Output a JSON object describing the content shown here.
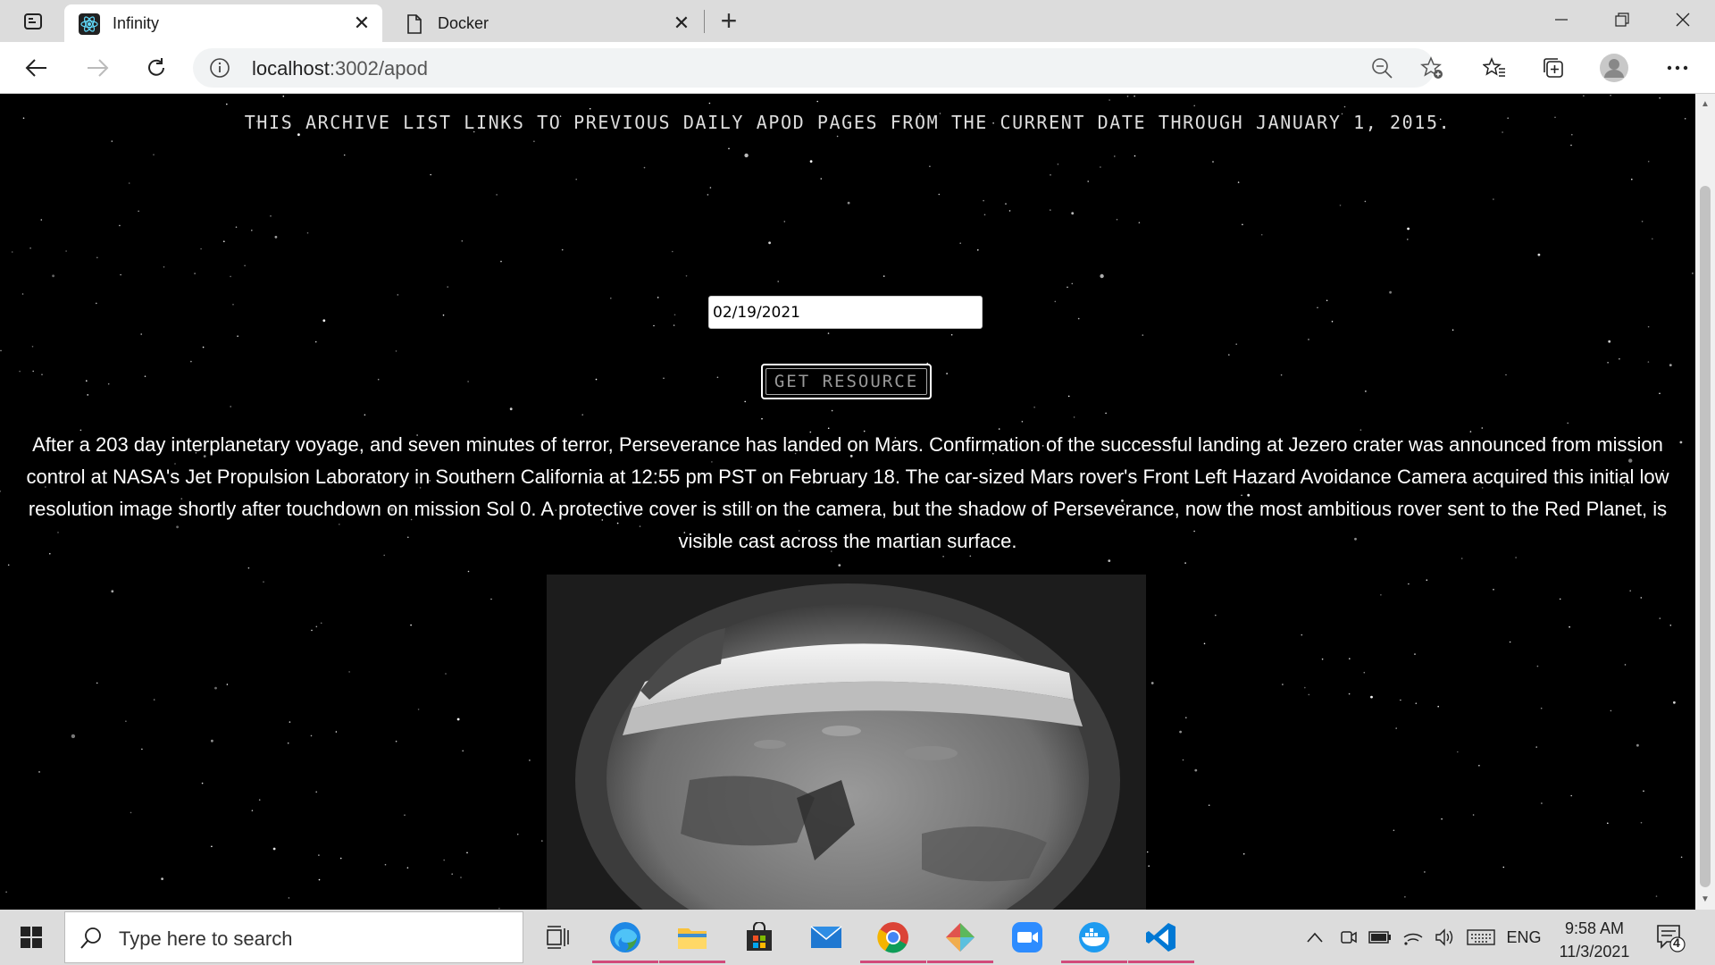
{
  "browser": {
    "tabs": [
      {
        "title": "Infinity",
        "active": true
      },
      {
        "title": "Docker",
        "active": false
      }
    ],
    "url_host": "localhost",
    "url_path": ":3002/apod"
  },
  "page": {
    "heading": "THIS ARCHIVE LIST LINKS TO PREVIOUS DAILY APOD PAGES FROM THE CURRENT DATE THROUGH JANUARY 1, 2015.",
    "date_value": "02/19/2021",
    "button_label": "GET RESOURCE",
    "explanation": "After a 203 day interplanetary voyage, and seven minutes of terror, Perseverance has landed on Mars. Confirmation of the successful landing at Jezero crater was announced from mission control at NASA's Jet Propulsion Laboratory in Southern California at 12:55 pm PST on February 18. The car-sized Mars rover's Front Left Hazard Avoidance Camera acquired this initial low resolution image shortly after touchdown on mission Sol 0. A protective cover is still on the camera, but the shadow of Perseverance, now the most ambitious rover sent to the Red Planet, is visible cast across the martian surface."
  },
  "taskbar": {
    "search_placeholder": "Type here to search",
    "language": "ENG",
    "time": "9:58 AM",
    "date": "11/3/2021",
    "notification_count": "4"
  }
}
